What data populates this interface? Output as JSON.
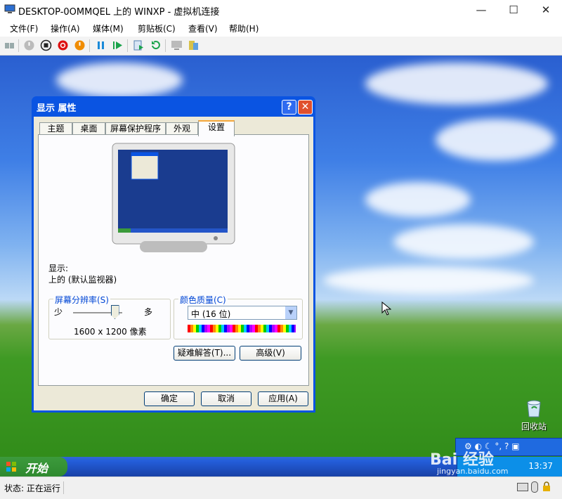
{
  "window": {
    "title": "DESKTOP-0OMMQEL 上的 WINXP - 虚拟机连接"
  },
  "menu": [
    "文件(F)",
    "操作(A)",
    "媒体(M)",
    "剪贴板(C)",
    "查看(V)",
    "帮助(H)"
  ],
  "toolbar_icons": [
    "ctrl-alt-del-icon",
    "start-icon",
    "turn-off-icon",
    "shutdown-icon",
    "power-icon",
    "pause-icon",
    "resume-icon",
    "checkpoint-icon",
    "revert-icon",
    "enhanced-session-icon",
    "share-icon"
  ],
  "dialog": {
    "title": "显示 属性",
    "help": "?",
    "close": "✕",
    "tabs": [
      "主题",
      "桌面",
      "屏幕保护程序",
      "外观",
      "设置"
    ],
    "active_tab": "设置",
    "display_label": "显示:",
    "display_value": "上的 (默认监视器)",
    "resolution": {
      "legend": "屏幕分辨率(S)",
      "min": "少",
      "max": "多",
      "value": "1600 x 1200 像素",
      "level": 0.85
    },
    "color": {
      "legend": "颜色质量(C)",
      "value": "中 (16 位)"
    },
    "troubleshoot": "疑难解答(T)...",
    "advanced": "高级(V)",
    "ok": "确定",
    "cancel": "取消",
    "apply": "应用(A)"
  },
  "desktop": {
    "recycle_bin": "回收站"
  },
  "taskbar": {
    "start": "开始",
    "clock": "13:37"
  },
  "status": {
    "text": "状态: 正在运行"
  },
  "watermark": {
    "brand": "Bai 经验",
    "url": "jingyan.baidu.com"
  }
}
